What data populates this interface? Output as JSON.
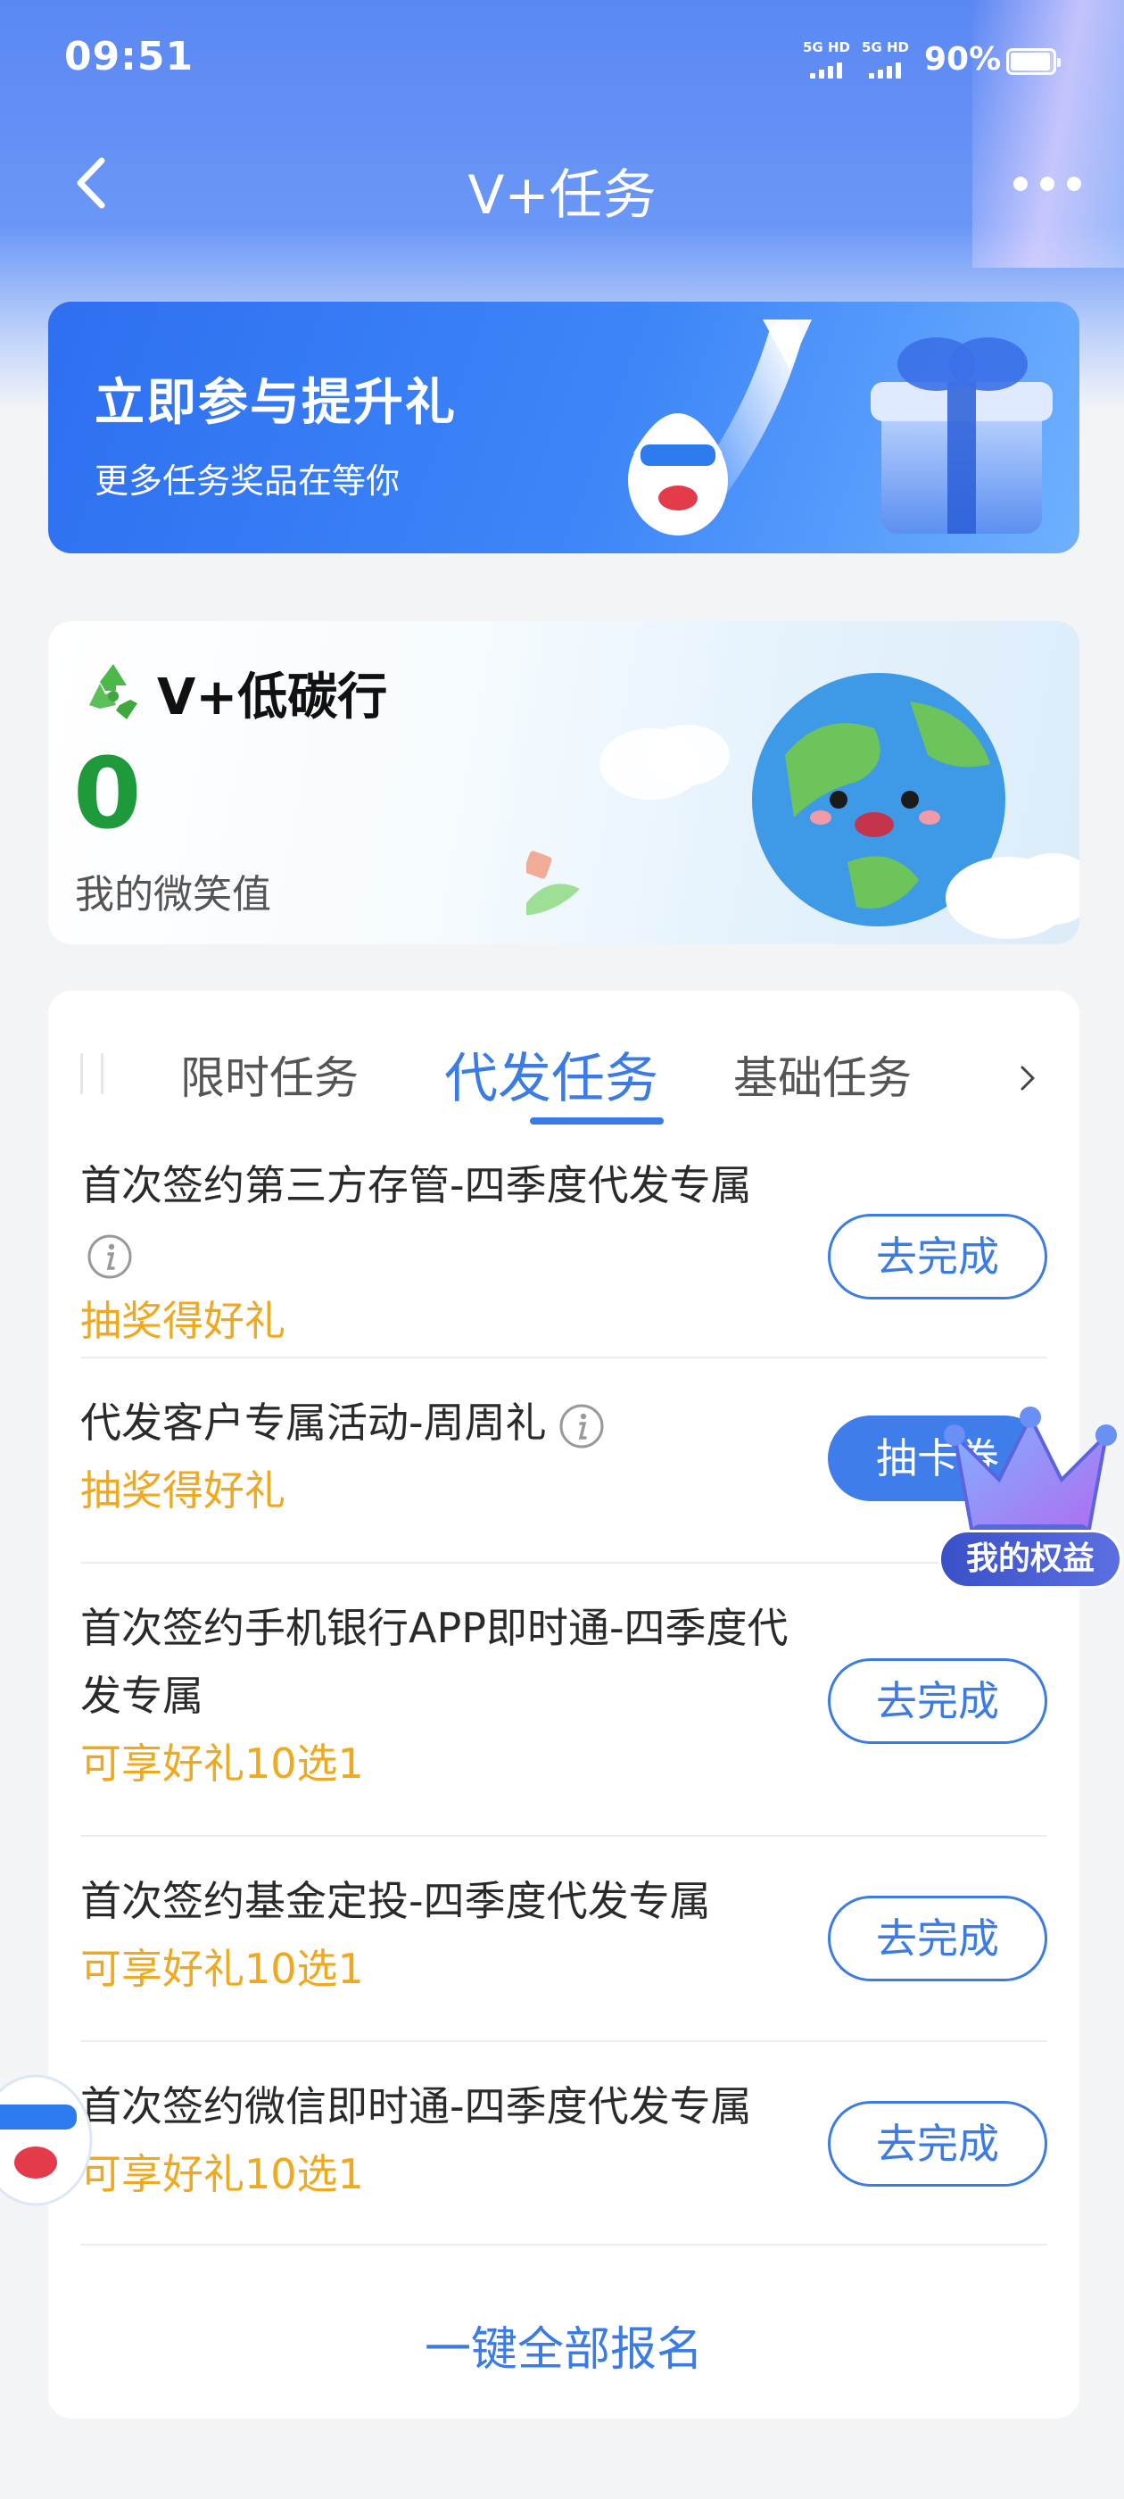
{
  "status_bar": {
    "time": "09:51",
    "signal_1_label": "5G HD",
    "signal_2_label": "5G HD",
    "battery": "90%"
  },
  "nav": {
    "title": "V+任务",
    "back_icon": "chevron-left-icon",
    "more_icon": "more-dots-icon"
  },
  "banner": {
    "title": "立即参与提升礼",
    "subtitle": "更多任务奖品在等你"
  },
  "carbon": {
    "title": "V+低碳行",
    "value": "0",
    "label": "我的微笑值"
  },
  "tabs": {
    "items": [
      "限时任务",
      "代发任务",
      "基础任务"
    ],
    "active_index": 1
  },
  "tasks": [
    {
      "title": "首次签约第三方存管-四季度代发专属",
      "has_info": true,
      "reward": "抽奖得好礼",
      "button": "去完成"
    },
    {
      "title": "代发客户专属活动-周周礼",
      "has_info": true,
      "reward": "抽奖得好礼",
      "button": "抽卡券"
    },
    {
      "title": "首次签约手机银行APP即时通-四季度代发专属",
      "has_info": false,
      "reward": "可享好礼10选1",
      "button": "去完成"
    },
    {
      "title": "首次签约基金定投-四季度代发专属",
      "has_info": false,
      "reward": "可享好礼10选1",
      "button": "去完成"
    },
    {
      "title": "首次签约微信即时通-四季度代发专属",
      "has_info": false,
      "reward": "可享好礼10选1",
      "button": "去完成"
    }
  ],
  "footer_action": "一键全部报名",
  "floating": {
    "rights_label": "我的权益"
  },
  "colors": {
    "primary": "#3b7be6",
    "reward": "#f0a81e",
    "carbon_value": "#1e9a3b"
  }
}
